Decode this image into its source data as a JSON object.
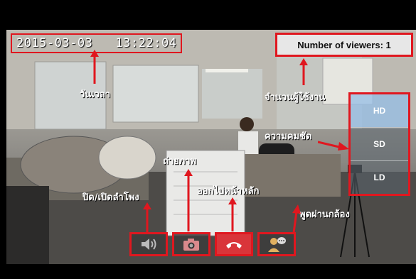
{
  "camera": {
    "timestamp": "2015-03-03   13:22:04",
    "viewers_label": "Number of viewers: 1"
  },
  "quality": {
    "options": [
      "HD",
      "SD",
      "LD"
    ],
    "selected": "HD"
  },
  "controls": {
    "speaker_icon": "speaker-icon",
    "camera_icon": "camera-icon",
    "hangup_icon": "phone-hangup-icon",
    "talk_icon": "person-talk-icon"
  },
  "annotations": {
    "datetime": "วันเวลา",
    "viewers": "จำนวนผู้ใช้งาน",
    "quality": "ความคมชัด",
    "snapshot": "ถ่ายภาพ",
    "exit": "ออกไปหน้าหลัก",
    "speaker": "ปิด/เปิดลำโพง",
    "talk": "พูดผ่านกล้อง"
  },
  "colors": {
    "highlight": "#e0171f",
    "hangup": "#d9353a"
  }
}
